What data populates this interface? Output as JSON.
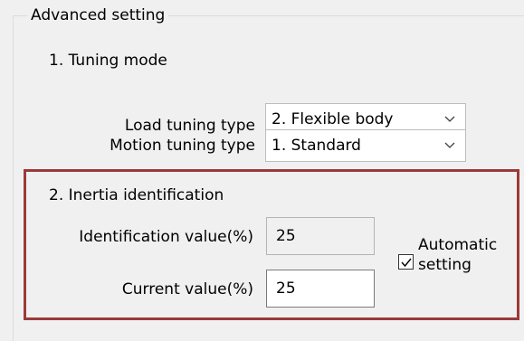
{
  "group": {
    "title": "Advanced setting"
  },
  "tuning_mode": {
    "title": "1. Tuning mode",
    "load_tuning": {
      "label": "Load tuning type",
      "selected": "2. Flexible body"
    },
    "motion_tuning": {
      "label": "Motion tuning type",
      "selected": "1. Standard"
    }
  },
  "inertia": {
    "title": "2. Inertia identification",
    "identification": {
      "label": "Identification value(%)",
      "value": "25"
    },
    "current": {
      "label": "Current value(%)",
      "value": "25"
    },
    "automatic": {
      "label_line1": "Automatic",
      "label_line2": "setting",
      "checked": true
    }
  },
  "colors": {
    "highlight_border": "#9b3a3a",
    "window_background": "#f0f0f0"
  },
  "icons": {
    "dropdown": "chevron-down-icon",
    "check": "check-icon"
  }
}
